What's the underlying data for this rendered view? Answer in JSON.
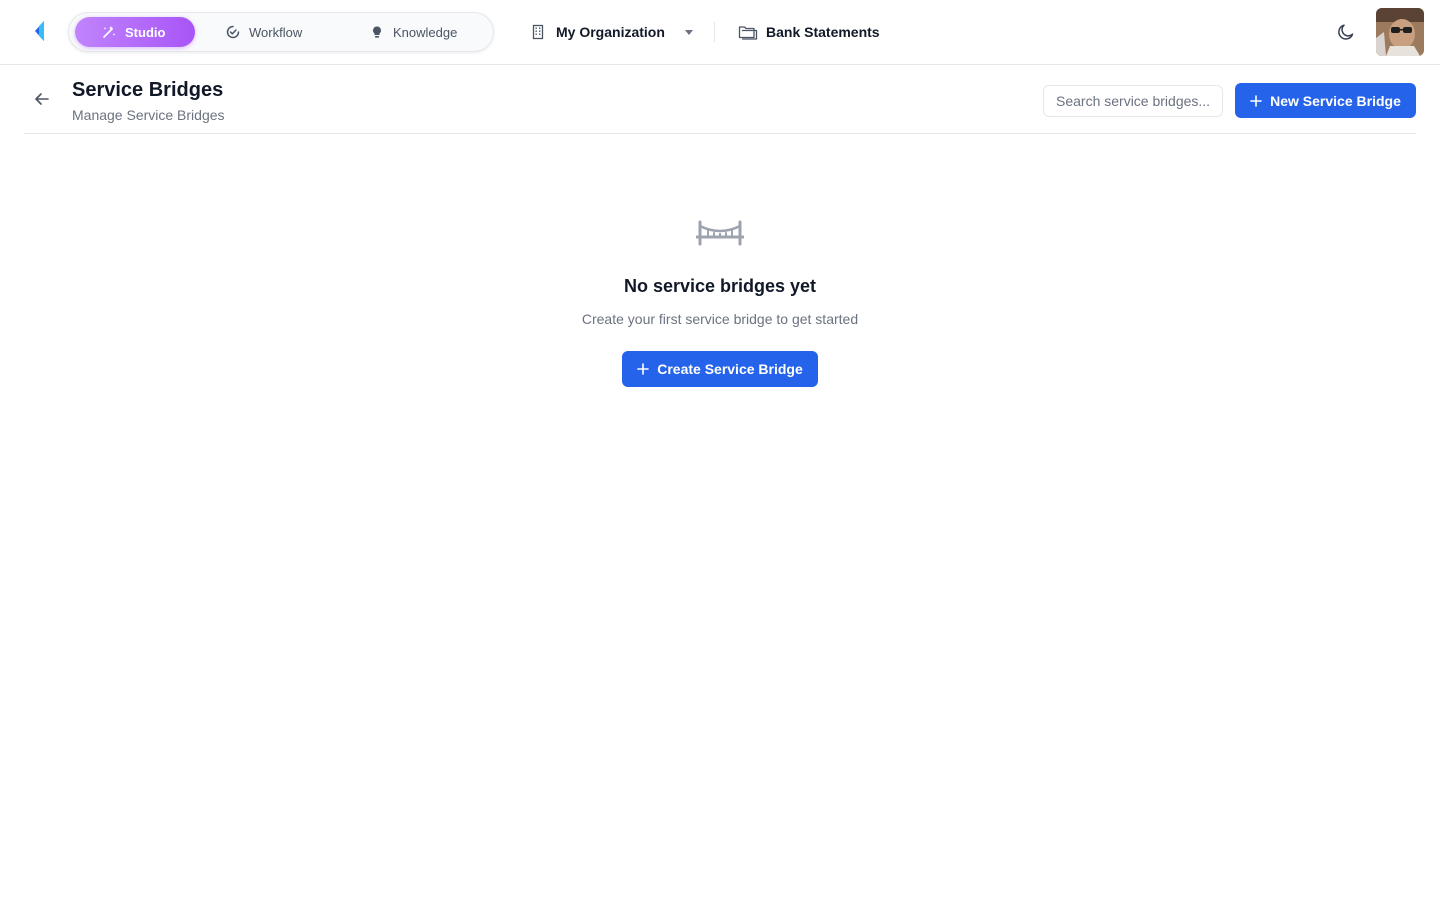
{
  "nav": {
    "modes": [
      {
        "label": "Studio",
        "icon": "wand-icon",
        "active": true
      },
      {
        "label": "Workflow",
        "icon": "check-progress-icon",
        "active": false
      },
      {
        "label": "Knowledge",
        "icon": "lightbulb-icon",
        "active": false
      }
    ],
    "organization": "My Organization",
    "project": "Bank Statements"
  },
  "header": {
    "title": "Service Bridges",
    "subtitle": "Manage Service Bridges",
    "search_placeholder": "Search service bridges...",
    "new_button": "New Service Bridge"
  },
  "empty_state": {
    "title": "No service bridges yet",
    "description": "Create your first service bridge to get started",
    "button": "Create Service Bridge"
  },
  "colors": {
    "primary": "#2563eb",
    "studio_accent": "#a855f7",
    "border": "#e5e7eb",
    "muted_text": "#6b7280"
  }
}
